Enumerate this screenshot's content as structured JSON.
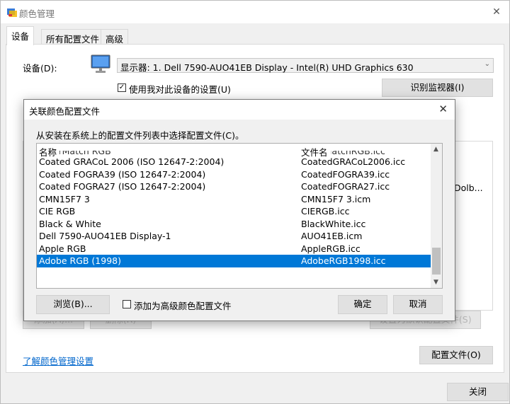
{
  "window": {
    "title": "颜色管理",
    "close_glyph": "✕"
  },
  "tabs": [
    "设备",
    "所有配置文件",
    "高级"
  ],
  "device": {
    "label": "设备(D):",
    "selected": "显示器: 1. Dell 7590-AUO41EB Display - Intel(R) UHD Graphics 630",
    "use_settings_label": "使用我对此设备的设置(U)",
    "use_settings_checked": true,
    "identify_button": "识别监视器(I)"
  },
  "background": {
    "partial_text": "Dolb...",
    "add_button": "添加(A)...",
    "remove_button": "删除(R)",
    "default_button": "设置为默认配置文件(S)",
    "link": "了解颜色管理设置",
    "profiles_button": "配置文件(O)",
    "close_button": "关闭"
  },
  "dialog": {
    "title": "关联颜色配置文件",
    "close_glyph": "✕",
    "instruction": "从安装在系统上的配置文件列表中选择配置文件(C)。",
    "columns": {
      "name": "名称",
      "file": "文件名"
    },
    "rows": [
      {
        "name": "ColorMatch RGB",
        "file": "ColorMatchRGB.icc",
        "partial": true
      },
      {
        "name": "Coated GRACoL 2006 (ISO 12647-2:2004)",
        "file": "CoatedGRACoL2006.icc"
      },
      {
        "name": "Coated FOGRA39 (ISO 12647-2:2004)",
        "file": "CoatedFOGRA39.icc"
      },
      {
        "name": "Coated FOGRA27 (ISO 12647-2:2004)",
        "file": "CoatedFOGRA27.icc"
      },
      {
        "name": " CMN15F7  3",
        "file": "CMN15F7  3.icm"
      },
      {
        "name": "CIE RGB",
        "file": "CIERGB.icc"
      },
      {
        "name": "Black & White",
        "file": "BlackWhite.icc"
      },
      {
        "name": "Dell 7590-AUO41EB Display-1",
        "file": "AUO41EB.icm"
      },
      {
        "name": "Apple RGB",
        "file": "AppleRGB.icc"
      },
      {
        "name": "Adobe RGB (1998)",
        "file": "AdobeRGB1998.icc",
        "selected": true
      }
    ],
    "browse_button": "浏览(B)...",
    "advanced_check_label": "添加为高级颜色配置文件",
    "advanced_checked": false,
    "ok_button": "确定",
    "cancel_button": "取消",
    "selection_color": "#0078d7"
  }
}
